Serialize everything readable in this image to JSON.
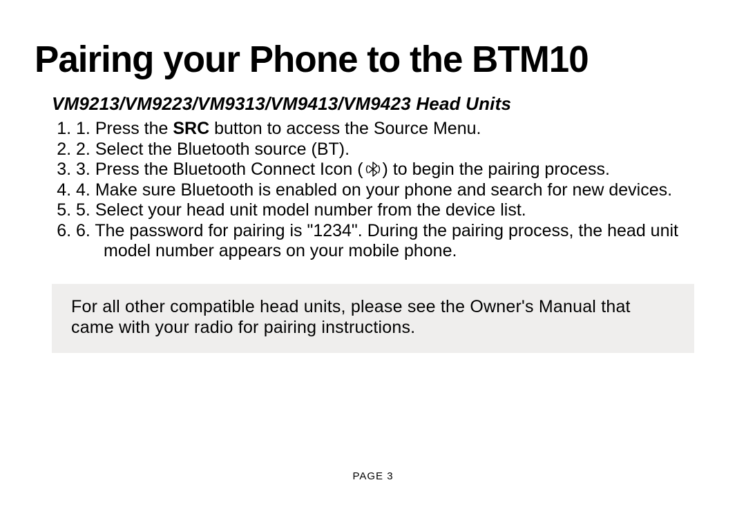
{
  "title": "Pairing your Phone to the BTM10",
  "subtitle": "VM9213/VM9223/VM9313/VM9413/VM9423 Head Units",
  "steps": {
    "s1_a": "Press the ",
    "s1_bold": "SRC",
    "s1_b": " button to access the Source Menu.",
    "s2": "Select the Bluetooth source (BT).",
    "s3_a": "Press the Bluetooth Connect Icon (",
    "s3_b": ") to begin the pairing process.",
    "s4": "Make sure Bluetooth is enabled on your phone and search for new devices.",
    "s5": "Select your head unit model number from the device list.",
    "s6": "The password for pairing is \"1234\". During the pairing process, the head unit model number appears on your mobile phone."
  },
  "note": "For all other compatible head units, please see the Owner's Manual that came with your radio for pairing instructions.",
  "footer": "PAGE 3"
}
